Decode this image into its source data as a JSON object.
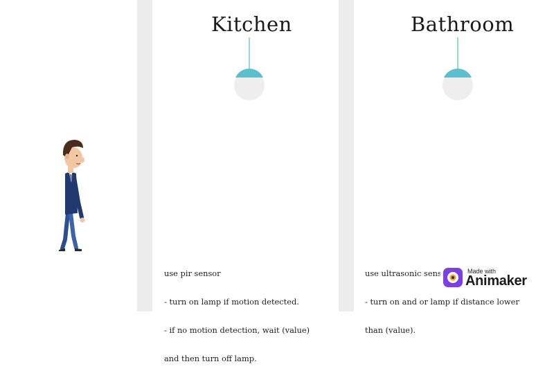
{
  "rooms": [
    {
      "title": "Kitchen",
      "note_lines": [
        "use pir sensor",
        "- turn on lamp if motion detected.",
        "- if no motion detection, wait (value)",
        "and then turn off lamp."
      ]
    },
    {
      "title": "Bathroom",
      "note_lines": [
        "use ultrasonic sensor",
        "- turn on and or lamp if distance lower",
        "than (value)."
      ]
    }
  ],
  "watermark": {
    "made_with": "Made with",
    "brand": "Animaker"
  },
  "colors": {
    "wall": "#ececec",
    "lamp_shade": "#5bbfcf",
    "lamp_bulb": "#eeeeee",
    "suit": "#203a70",
    "skin": "#f1c8a3",
    "hair": "#4a2b1c",
    "logo_purple": "#7b3fe4",
    "logo_orange": "#f7a21b"
  }
}
